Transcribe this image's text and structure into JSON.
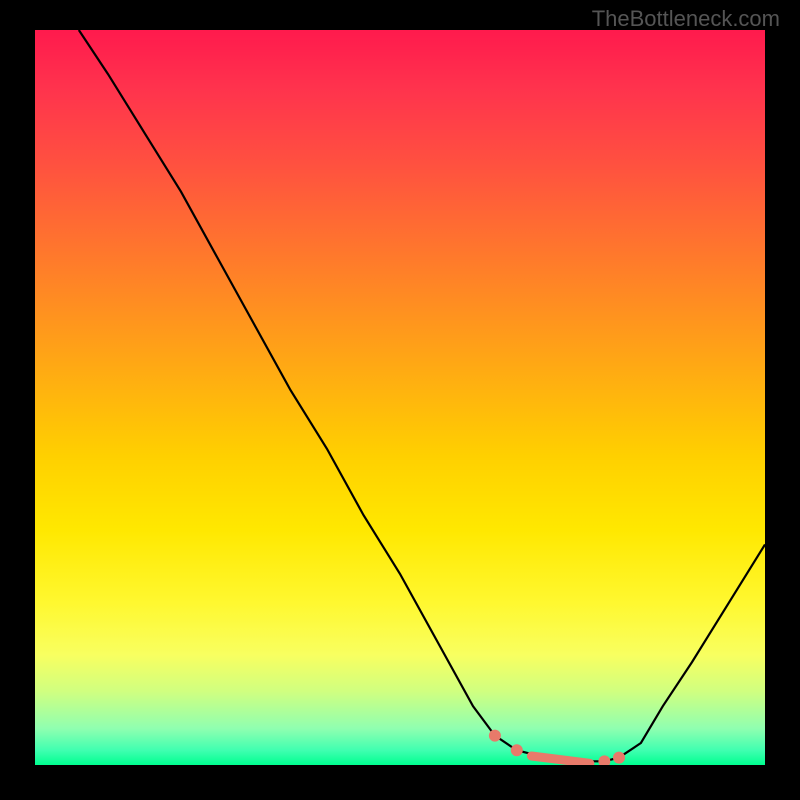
{
  "watermark": "TheBottleneck.com",
  "chart_data": {
    "type": "line",
    "title": "",
    "xlabel": "",
    "ylabel": "",
    "xlim": [
      0,
      100
    ],
    "ylim": [
      0,
      100
    ],
    "grid": false,
    "legend": false,
    "series": [
      {
        "name": "curve",
        "x": [
          6,
          10,
          15,
          20,
          25,
          30,
          35,
          40,
          45,
          50,
          55,
          60,
          63,
          66,
          70,
          74,
          78,
          80,
          83,
          86,
          90,
          95,
          100
        ],
        "y": [
          100,
          94,
          86,
          78,
          69,
          60,
          51,
          43,
          34,
          26,
          17,
          8,
          4,
          2,
          1,
          0.5,
          0.5,
          1,
          3,
          8,
          14,
          22,
          30
        ]
      }
    ],
    "markers": {
      "dots_x": [
        63,
        66,
        78,
        80
      ],
      "dashes_x": [
        [
          68,
          76
        ]
      ]
    },
    "background_gradient": {
      "top": "#ff1a4d",
      "mid": "#ffe800",
      "bottom": "#00ff90"
    }
  }
}
